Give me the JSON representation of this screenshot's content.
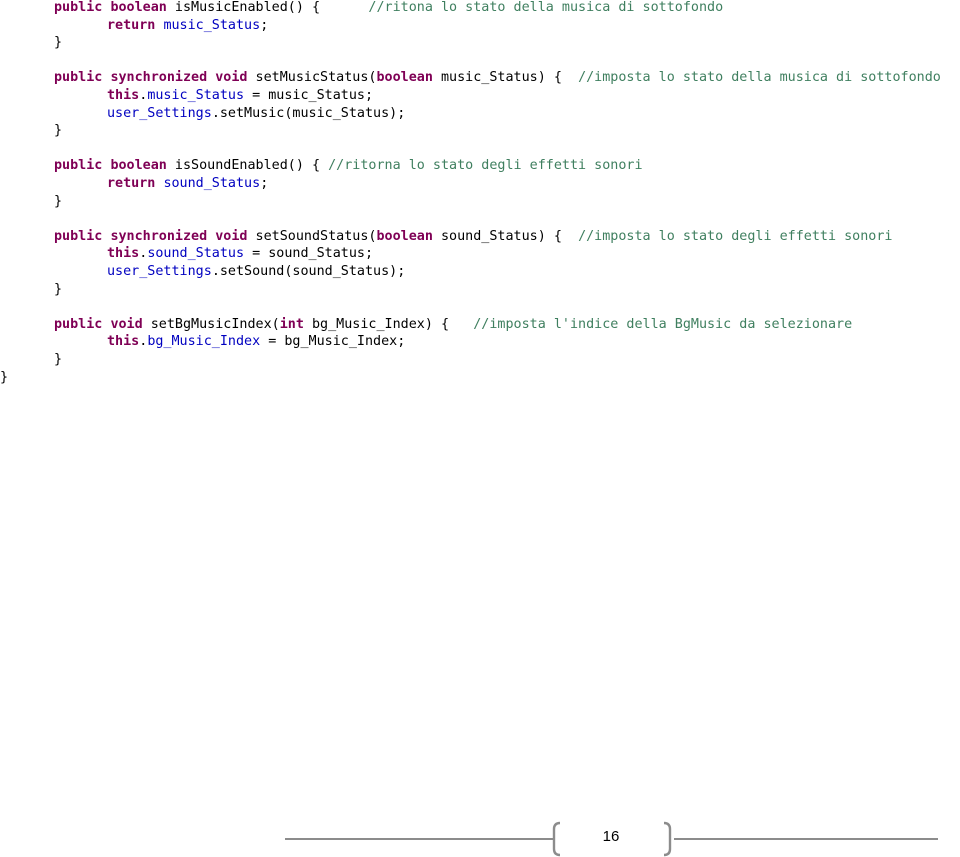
{
  "code": {
    "lines": [
      {
        "indent": 1,
        "tokens": [
          {
            "t": "kw",
            "v": "public"
          },
          {
            "t": "txt",
            "v": " "
          },
          {
            "t": "kw",
            "v": "boolean"
          },
          {
            "t": "txt",
            "v": " isMusicEnabled() {      "
          },
          {
            "t": "cm",
            "v": "//ritona lo stato della musica di sottofondo"
          }
        ]
      },
      {
        "indent": 2,
        "tokens": [
          {
            "t": "kw",
            "v": "return"
          },
          {
            "t": "txt",
            "v": " "
          },
          {
            "t": "fld",
            "v": "music_Status"
          },
          {
            "t": "txt",
            "v": ";"
          }
        ]
      },
      {
        "indent": 1,
        "tokens": [
          {
            "t": "txt",
            "v": "}"
          }
        ]
      },
      {
        "indent": 0,
        "tokens": []
      },
      {
        "indent": 1,
        "tokens": [
          {
            "t": "kw",
            "v": "public"
          },
          {
            "t": "txt",
            "v": " "
          },
          {
            "t": "kw",
            "v": "synchronized"
          },
          {
            "t": "txt",
            "v": " "
          },
          {
            "t": "kw",
            "v": "void"
          },
          {
            "t": "txt",
            "v": " setMusicStatus("
          },
          {
            "t": "kw",
            "v": "boolean"
          },
          {
            "t": "txt",
            "v": " music_Status) {  "
          },
          {
            "t": "cm",
            "v": "//imposta lo stato della musica di sottofondo"
          }
        ]
      },
      {
        "indent": 2,
        "tokens": [
          {
            "t": "kw",
            "v": "this"
          },
          {
            "t": "txt",
            "v": "."
          },
          {
            "t": "fld",
            "v": "music_Status"
          },
          {
            "t": "txt",
            "v": " = music_Status;"
          }
        ]
      },
      {
        "indent": 2,
        "tokens": [
          {
            "t": "fld",
            "v": "user_Settings"
          },
          {
            "t": "txt",
            "v": ".setMusic(music_Status);"
          }
        ]
      },
      {
        "indent": 1,
        "tokens": [
          {
            "t": "txt",
            "v": "}"
          }
        ]
      },
      {
        "indent": 0,
        "tokens": []
      },
      {
        "indent": 1,
        "tokens": [
          {
            "t": "kw",
            "v": "public"
          },
          {
            "t": "txt",
            "v": " "
          },
          {
            "t": "kw",
            "v": "boolean"
          },
          {
            "t": "txt",
            "v": " isSoundEnabled() { "
          },
          {
            "t": "cm",
            "v": "//ritorna lo stato degli effetti sonori"
          }
        ]
      },
      {
        "indent": 2,
        "tokens": [
          {
            "t": "kw",
            "v": "return"
          },
          {
            "t": "txt",
            "v": " "
          },
          {
            "t": "fld",
            "v": "sound_Status"
          },
          {
            "t": "txt",
            "v": ";"
          }
        ]
      },
      {
        "indent": 1,
        "tokens": [
          {
            "t": "txt",
            "v": "}"
          }
        ]
      },
      {
        "indent": 0,
        "tokens": []
      },
      {
        "indent": 1,
        "tokens": [
          {
            "t": "kw",
            "v": "public"
          },
          {
            "t": "txt",
            "v": " "
          },
          {
            "t": "kw",
            "v": "synchronized"
          },
          {
            "t": "txt",
            "v": " "
          },
          {
            "t": "kw",
            "v": "void"
          },
          {
            "t": "txt",
            "v": " setSoundStatus("
          },
          {
            "t": "kw",
            "v": "boolean"
          },
          {
            "t": "txt",
            "v": " sound_Status) {  "
          },
          {
            "t": "cm",
            "v": "//imposta lo stato degli effetti sonori"
          }
        ]
      },
      {
        "indent": 2,
        "tokens": [
          {
            "t": "kw",
            "v": "this"
          },
          {
            "t": "txt",
            "v": "."
          },
          {
            "t": "fld",
            "v": "sound_Status"
          },
          {
            "t": "txt",
            "v": " = sound_Status;"
          }
        ]
      },
      {
        "indent": 2,
        "tokens": [
          {
            "t": "fld",
            "v": "user_Settings"
          },
          {
            "t": "txt",
            "v": ".setSound(sound_Status);"
          }
        ]
      },
      {
        "indent": 1,
        "tokens": [
          {
            "t": "txt",
            "v": "}"
          }
        ]
      },
      {
        "indent": 0,
        "tokens": []
      },
      {
        "indent": 1,
        "tokens": [
          {
            "t": "kw",
            "v": "public"
          },
          {
            "t": "txt",
            "v": " "
          },
          {
            "t": "kw",
            "v": "void"
          },
          {
            "t": "txt",
            "v": " setBgMusicIndex("
          },
          {
            "t": "kw",
            "v": "int"
          },
          {
            "t": "txt",
            "v": " bg_Music_Index) {   "
          },
          {
            "t": "cm",
            "v": "//imposta l'indice della BgMusic da selezionare"
          }
        ]
      },
      {
        "indent": 2,
        "tokens": [
          {
            "t": "kw",
            "v": "this"
          },
          {
            "t": "txt",
            "v": "."
          },
          {
            "t": "fld",
            "v": "bg_Music_Index"
          },
          {
            "t": "txt",
            "v": " = bg_Music_Index;"
          }
        ]
      },
      {
        "indent": 1,
        "tokens": [
          {
            "t": "txt",
            "v": "}"
          }
        ]
      },
      {
        "indent": 0,
        "tokens": [
          {
            "t": "txt",
            "v": "}"
          }
        ]
      }
    ]
  },
  "footer": {
    "page_number": "16"
  }
}
